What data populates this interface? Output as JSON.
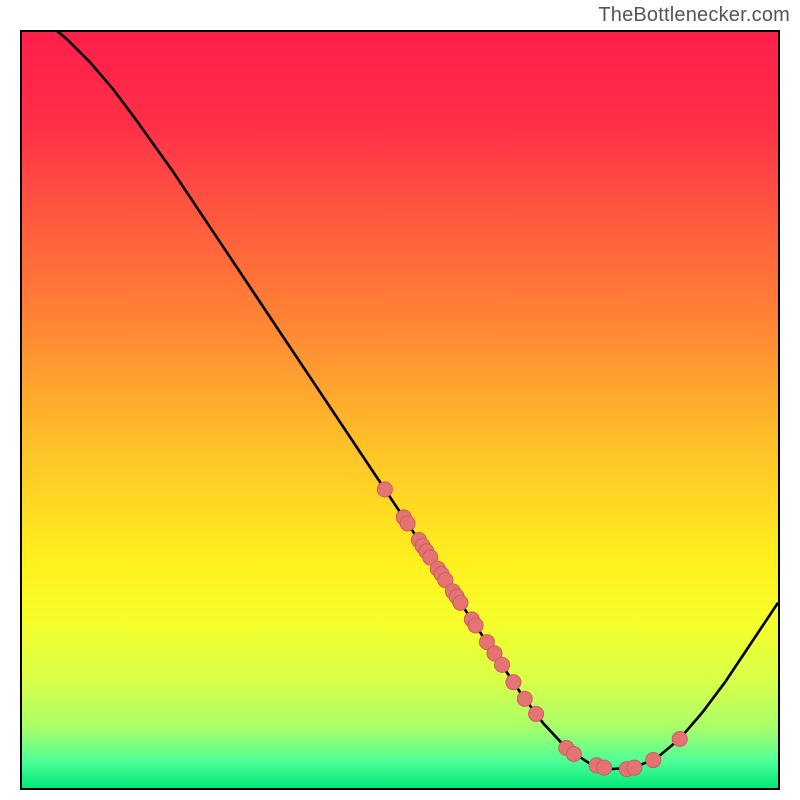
{
  "attribution": "TheBottlenecker.com",
  "chart_data": {
    "type": "line",
    "title": "",
    "xlabel": "",
    "ylabel": "",
    "xlim": [
      0,
      100
    ],
    "ylim": [
      0,
      100
    ],
    "background_gradient": {
      "stops": [
        {
          "offset": 0.0,
          "color": "#ff1f4a"
        },
        {
          "offset": 0.12,
          "color": "#ff2f48"
        },
        {
          "offset": 0.25,
          "color": "#ff5a3e"
        },
        {
          "offset": 0.4,
          "color": "#ff8a34"
        },
        {
          "offset": 0.55,
          "color": "#ffc228"
        },
        {
          "offset": 0.7,
          "color": "#fff01e"
        },
        {
          "offset": 0.78,
          "color": "#f5ff2a"
        },
        {
          "offset": 0.86,
          "color": "#d8ff4a"
        },
        {
          "offset": 0.92,
          "color": "#a8ff6a"
        },
        {
          "offset": 0.965,
          "color": "#4dff98"
        },
        {
          "offset": 1.0,
          "color": "#00e878"
        }
      ]
    },
    "series": [
      {
        "name": "bottleneck-curve",
        "color": "#000000",
        "points": [
          {
            "x": 0.0,
            "y": 103.0
          },
          {
            "x": 3.0,
            "y": 101.5
          },
          {
            "x": 6.0,
            "y": 99.0
          },
          {
            "x": 9.0,
            "y": 96.0
          },
          {
            "x": 12.0,
            "y": 92.5
          },
          {
            "x": 15.0,
            "y": 88.5
          },
          {
            "x": 20.0,
            "y": 81.5
          },
          {
            "x": 25.0,
            "y": 74.0
          },
          {
            "x": 30.0,
            "y": 66.5
          },
          {
            "x": 35.0,
            "y": 59.0
          },
          {
            "x": 40.0,
            "y": 51.5
          },
          {
            "x": 45.0,
            "y": 44.0
          },
          {
            "x": 50.0,
            "y": 36.5
          },
          {
            "x": 55.0,
            "y": 29.0
          },
          {
            "x": 60.0,
            "y": 21.5
          },
          {
            "x": 63.0,
            "y": 17.0
          },
          {
            "x": 66.0,
            "y": 12.5
          },
          {
            "x": 69.0,
            "y": 8.5
          },
          {
            "x": 72.0,
            "y": 5.3
          },
          {
            "x": 75.0,
            "y": 3.3
          },
          {
            "x": 78.0,
            "y": 2.5
          },
          {
            "x": 81.0,
            "y": 2.7
          },
          {
            "x": 84.0,
            "y": 4.0
          },
          {
            "x": 87.0,
            "y": 6.5
          },
          {
            "x": 90.0,
            "y": 10.0
          },
          {
            "x": 93.0,
            "y": 14.0
          },
          {
            "x": 96.0,
            "y": 18.5
          },
          {
            "x": 100.0,
            "y": 24.5
          }
        ]
      }
    ],
    "markers": {
      "color": "#e57373",
      "stroke": "#c95b5b",
      "radius": 1.0,
      "points": [
        {
          "x": 48.0,
          "y": 39.5
        },
        {
          "x": 50.5,
          "y": 35.8
        },
        {
          "x": 51.0,
          "y": 35.0
        },
        {
          "x": 52.5,
          "y": 32.8
        },
        {
          "x": 53.0,
          "y": 32.0
        },
        {
          "x": 53.5,
          "y": 31.3
        },
        {
          "x": 54.0,
          "y": 30.5
        },
        {
          "x": 55.0,
          "y": 29.0
        },
        {
          "x": 55.5,
          "y": 28.3
        },
        {
          "x": 56.0,
          "y": 27.5
        },
        {
          "x": 57.0,
          "y": 26.0
        },
        {
          "x": 57.5,
          "y": 25.3
        },
        {
          "x": 58.0,
          "y": 24.5
        },
        {
          "x": 59.5,
          "y": 22.3
        },
        {
          "x": 60.0,
          "y": 21.5
        },
        {
          "x": 61.5,
          "y": 19.3
        },
        {
          "x": 62.5,
          "y": 17.8
        },
        {
          "x": 63.5,
          "y": 16.3
        },
        {
          "x": 65.0,
          "y": 14.0
        },
        {
          "x": 66.5,
          "y": 11.8
        },
        {
          "x": 68.0,
          "y": 9.8
        },
        {
          "x": 72.0,
          "y": 5.3
        },
        {
          "x": 73.0,
          "y": 4.5
        },
        {
          "x": 76.0,
          "y": 3.0
        },
        {
          "x": 77.0,
          "y": 2.7
        },
        {
          "x": 80.0,
          "y": 2.5
        },
        {
          "x": 81.0,
          "y": 2.7
        },
        {
          "x": 83.5,
          "y": 3.7
        },
        {
          "x": 87.0,
          "y": 6.5
        }
      ]
    }
  }
}
